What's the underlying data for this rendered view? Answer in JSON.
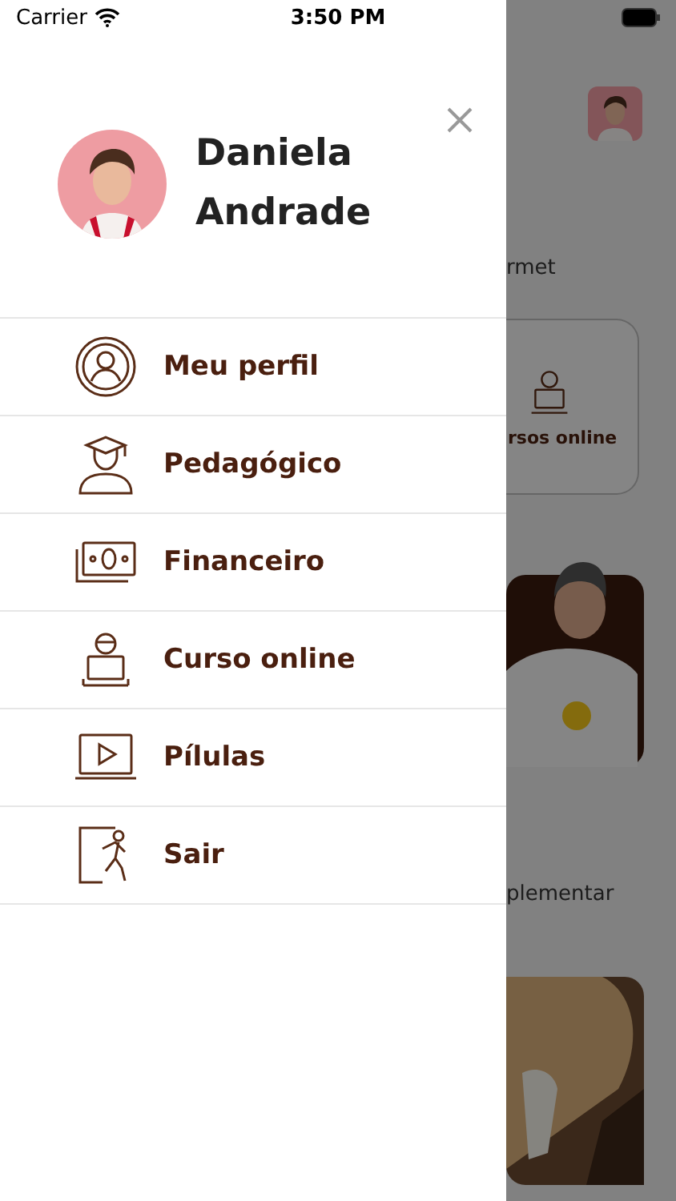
{
  "status_bar": {
    "carrier": "Carrier",
    "time": "3:50 PM"
  },
  "drawer": {
    "user_name": "Daniela Andrade",
    "menu": [
      {
        "label": "Meu perfil",
        "kind": "profile"
      },
      {
        "label": "Pedagógico",
        "kind": "graduate"
      },
      {
        "label": "Financeiro",
        "kind": "money"
      },
      {
        "label": "Curso online",
        "kind": "laptop"
      },
      {
        "label": "Pílulas",
        "kind": "video"
      },
      {
        "label": "Sair",
        "kind": "exit"
      }
    ]
  },
  "background": {
    "heading_1": "rmet",
    "card_label": "rsos online",
    "heading_2": "plementar"
  }
}
